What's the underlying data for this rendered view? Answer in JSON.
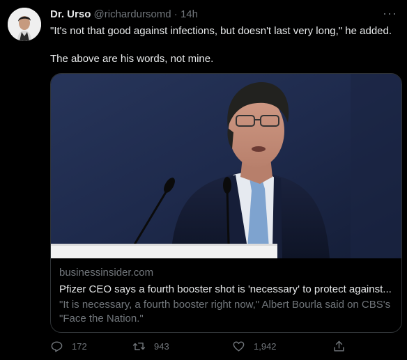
{
  "tweet": {
    "display_name": "Dr. Urso",
    "handle": "@richardursomd",
    "separator": "·",
    "time": "14h",
    "more_label": "···",
    "text_lines": [
      "\"It's not that good against infections, but doesn't last very long,\" he added.",
      "The above are his words, not mine."
    ]
  },
  "card": {
    "domain": "businessinsider.com",
    "title": "Pfizer CEO says a fourth booster shot is 'necessary' to protect against...",
    "description": "\"It is necessary, a fourth booster right now,\" Albert Bourla said on CBS's \"Face the Nation.\""
  },
  "actions": {
    "reply_count": "172",
    "retweet_count": "943",
    "like_count": "1,942"
  },
  "icons": {
    "reply": "reply-icon",
    "retweet": "retweet-icon",
    "like": "heart-icon",
    "share": "share-icon",
    "more": "more-icon"
  },
  "colors": {
    "background": "#000000",
    "text": "#e7e9ea",
    "secondary": "#71767b",
    "border": "#2f3336"
  }
}
